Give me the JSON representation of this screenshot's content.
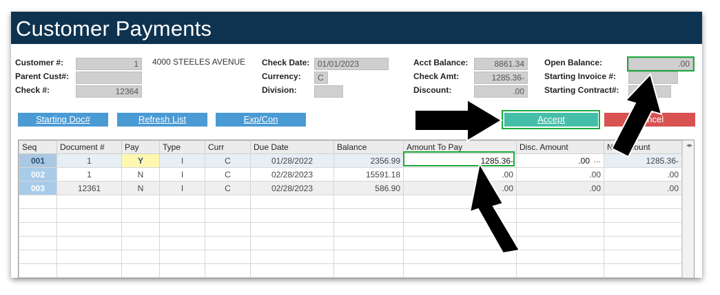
{
  "window": {
    "title": "Customer Payments"
  },
  "form": {
    "customer_label": "Customer #:",
    "customer_value": "1",
    "customer_name": "4000 STEELES AVENUE",
    "parent_label": "Parent Cust#:",
    "parent_value": "",
    "check_label": "Check #:",
    "check_value": "12364",
    "check_date_label": "Check Date:",
    "check_date_value": "01/01/2023",
    "currency_label": "Currency:",
    "currency_value": "C",
    "division_label": "Division:",
    "division_value": "",
    "acct_balance_label": "Acct Balance:",
    "acct_balance_value": "8861.34",
    "check_amt_label": "Check Amt:",
    "check_amt_value": "1285.36-",
    "discount_label": "Discount:",
    "discount_value": ".00",
    "open_balance_label": "Open Balance:",
    "open_balance_value": ".00",
    "starting_invoice_label": "Starting Invoice #:",
    "starting_invoice_value": "",
    "starting_contract_label": "Starting Contract#:",
    "starting_contract_value": ""
  },
  "buttons": {
    "starting_doc": "Starting Doc#",
    "refresh_list": "Refresh List",
    "exp_con": "Exp/Con",
    "accept": "Accept",
    "cancel": "Cancel"
  },
  "grid": {
    "headers": [
      "Seq",
      "Document #",
      "Pay",
      "Type",
      "Curr",
      "Due Date",
      "Balance",
      "Amount To Pay",
      "Disc. Amount",
      "Net Amount"
    ],
    "rows": [
      {
        "seq": "001",
        "doc": "1",
        "pay": "Y",
        "type": "I",
        "curr": "C",
        "due": "01/28/2022",
        "balance": "2356.99",
        "amount_to_pay": "1285.36-",
        "disc": ".00",
        "net": "1285.36-"
      },
      {
        "seq": "002",
        "doc": "1",
        "pay": "N",
        "type": "I",
        "curr": "C",
        "due": "02/28/2023",
        "balance": "15591.18",
        "amount_to_pay": ".00",
        "disc": ".00",
        "net": ".00"
      },
      {
        "seq": "003",
        "doc": "12361",
        "pay": "N",
        "type": "I",
        "curr": "C",
        "due": "02/28/2023",
        "balance": "586.90",
        "amount_to_pay": ".00",
        "disc": ".00",
        "net": ".00"
      }
    ],
    "disc_ellipsis": "···"
  },
  "colors": {
    "titlebar": "#0e3350",
    "button_blue": "#4a9ad4",
    "button_accept": "#45bfa9",
    "button_cancel": "#d85252",
    "highlight": "#1aaa3a"
  }
}
